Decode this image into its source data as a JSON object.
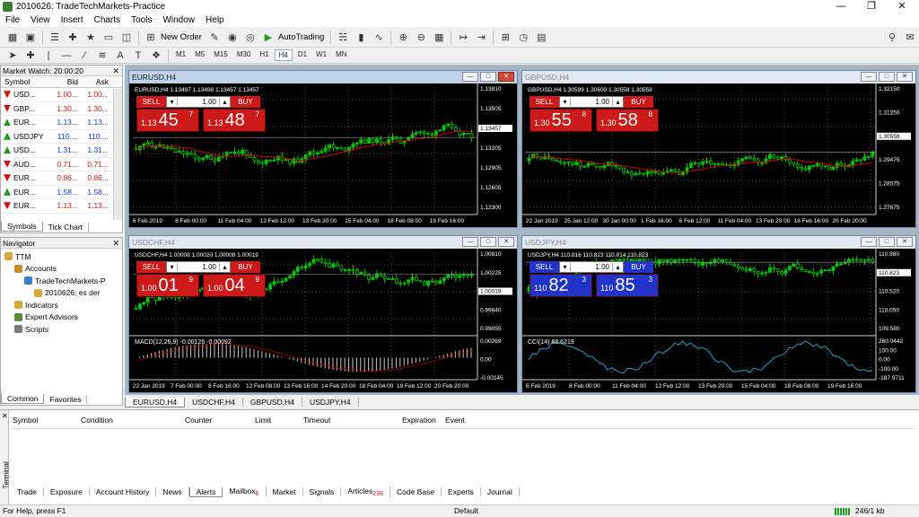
{
  "window": {
    "title": "2010626: TradeTechMarkets-Practice"
  },
  "menu": [
    "File",
    "View",
    "Insert",
    "Charts",
    "Tools",
    "Window",
    "Help"
  ],
  "toolbar": {
    "new_order": "New Order",
    "autotrading": "AutoTrading"
  },
  "timeframes": [
    "M1",
    "M5",
    "M15",
    "M30",
    "H1",
    "H4",
    "D1",
    "W1",
    "MN"
  ],
  "active_timeframe": "H4",
  "market_watch": {
    "title": "Market Watch: 20:00:20",
    "headers": {
      "symbol": "Symbol",
      "bid": "Bid",
      "ask": "Ask"
    },
    "rows": [
      {
        "symbol": "USD...",
        "bid": "1.00...",
        "ask": "1.00...",
        "dir": "dn"
      },
      {
        "symbol": "GBP...",
        "bid": "1.30...",
        "ask": "1.30...",
        "dir": "dn"
      },
      {
        "symbol": "EUR...",
        "bid": "1.13...",
        "ask": "1.13...",
        "dir": "up"
      },
      {
        "symbol": "USDJPY",
        "bid": "110....",
        "ask": "110....",
        "dir": "up"
      },
      {
        "symbol": "USD...",
        "bid": "1.31...",
        "ask": "1.31...",
        "dir": "up"
      },
      {
        "symbol": "AUD...",
        "bid": "0.71...",
        "ask": "0.71...",
        "dir": "dn"
      },
      {
        "symbol": "EUR...",
        "bid": "0.86...",
        "ask": "0.86...",
        "dir": "dn"
      },
      {
        "symbol": "EUR...",
        "bid": "1.58...",
        "ask": "1.58...",
        "dir": "up"
      },
      {
        "symbol": "EUR...",
        "bid": "1.13...",
        "ask": "1.13...",
        "dir": "dn"
      }
    ],
    "tabs": [
      "Symbols",
      "Tick Chart"
    ]
  },
  "navigator": {
    "title": "Navigator",
    "items": [
      {
        "label": "TTM",
        "indent": 0,
        "color": "#d6a93a"
      },
      {
        "label": "Accounts",
        "indent": 1,
        "color": "#c98b2a"
      },
      {
        "label": "TradeTechMarkets-P",
        "indent": 2,
        "color": "#3a7fd0"
      },
      {
        "label": "2010626: es der",
        "indent": 3,
        "color": "#d6a93a"
      },
      {
        "label": "Indicators",
        "indent": 1,
        "color": "#d6a93a"
      },
      {
        "label": "Expert Advisors",
        "indent": 1,
        "color": "#5a8a3a"
      },
      {
        "label": "Scripts",
        "indent": 1,
        "color": "#7a7a7a"
      }
    ],
    "tabs": [
      "Common",
      "Favorites"
    ]
  },
  "charts": [
    {
      "title": "EURUSD,H4",
      "active": true,
      "info": "EURUSD,H4  1.13497 1.13498 1.13457 1.13457",
      "sell_small": "1.13",
      "sell_big": "45",
      "sell_sup": "7",
      "buy_small": "1.13",
      "buy_big": "48",
      "buy_sup": "7",
      "volume": "1.00",
      "sell": "SELL",
      "buy": "BUY",
      "price_labels": [
        "1.13810",
        "1.13505",
        "1.13457",
        "1.13205",
        "1.12905",
        "1.12605",
        "1.12300"
      ],
      "current_price": "1.13457",
      "x_labels": [
        "6 Feb 2019",
        "8 Feb 00:00",
        "11 Feb 04:00",
        "12 Feb 12:00",
        "13 Feb 20:00",
        "15 Feb 04:00",
        "18 Feb 08:00",
        "19 Feb 16:00"
      ]
    },
    {
      "title": "GBPUSD,H4",
      "active": false,
      "info": "GBPUSD,H4  1.30599 1.30600 1.30558 1.30558",
      "sell_small": "1.30",
      "sell_big": "55",
      "sell_sup": "8",
      "buy_small": "1.30",
      "buy_big": "58",
      "buy_sup": "8",
      "volume": "1.00",
      "sell": "SELL",
      "buy": "BUY",
      "price_labels": [
        "1.32150",
        "1.31250",
        "1.30558",
        "1.29475",
        "1.28575",
        "1.27675"
      ],
      "current_price": "1.30558",
      "x_labels": [
        "22 Jan 2019",
        "25 Jan 12:00",
        "30 Jan 00:00",
        "1 Feb 16:00",
        "6 Feb 12:00",
        "11 Feb 04:00",
        "13 Feb 20:00",
        "18 Feb 16:00",
        "20 Feb 20:00"
      ]
    },
    {
      "title": "USDCHF,H4",
      "active": false,
      "info": "USDCHF,H4  1.00008 1.00020 1.00008 1.00019",
      "sell_small": "1.00",
      "sell_big": "01",
      "sell_sup": "9",
      "buy_small": "1.00",
      "buy_big": "04",
      "buy_sup": "9",
      "volume": "1.00",
      "sell": "SELL",
      "buy": "BUY",
      "price_labels": [
        "1.00810",
        "1.00225",
        "1.00019",
        "0.99640",
        "0.99055"
      ],
      "current_price": "1.00019",
      "indicator": "MACD(12,26,9) -0.00126 -0.00092",
      "indicator_labels": [
        "0.00269",
        "0.00",
        "-0.00145"
      ],
      "x_labels": [
        "22 Jan 2019",
        "7 Feb 00:00",
        "8 Feb 16:00",
        "12 Feb 08:00",
        "13 Feb 16:00",
        "14 Feb 20:00",
        "18 Feb 04:00",
        "19 Feb 12:00",
        "20 Feb 20:00"
      ]
    },
    {
      "title": "USDJPY,H4",
      "active": false,
      "info": "USDJPY,H4  110.816 110.823 110.814 110.823",
      "sell_small": "110",
      "sell_big": "82",
      "sell_sup": "3",
      "buy_small": "110",
      "buy_big": "85",
      "buy_sup": "3",
      "volume": "1.00",
      "sell": "SELL",
      "buy": "BUY",
      "price_labels": [
        "110.980",
        "110.823",
        "110.520",
        "110.050",
        "109.580"
      ],
      "current_price": "110.823",
      "indicator": "CCI(14) 88.6219",
      "indicator_labels": [
        "260.0442",
        "100.00",
        "0.00",
        "-100.00",
        "-187.9711"
      ],
      "x_labels": [
        "6 Feb 2019",
        "8 Feb 00:00",
        "11 Feb 04:00",
        "12 Feb 12:00",
        "13 Feb 20:00",
        "15 Feb 04:00",
        "18 Feb 08:00",
        "19 Feb 16:00"
      ]
    }
  ],
  "chart_tabs": [
    "EURUSD,H4",
    "USDCHF,H4",
    "GBPUSD,H4",
    "USDJPY,H4"
  ],
  "terminal": {
    "label": "Terminal",
    "headers": [
      "Symbol",
      "Condition",
      "Counter",
      "Limit",
      "Timeout",
      "Expiration",
      "Event"
    ],
    "tabs": [
      {
        "label": "Trade"
      },
      {
        "label": "Exposure"
      },
      {
        "label": "Account History"
      },
      {
        "label": "News"
      },
      {
        "label": "Alerts",
        "active": true
      },
      {
        "label": "Mailbox",
        "badge": "6"
      },
      {
        "label": "Market"
      },
      {
        "label": "Signals"
      },
      {
        "label": "Articles",
        "badge": "238"
      },
      {
        "label": "Code Base"
      },
      {
        "label": "Experts"
      },
      {
        "label": "Journal"
      }
    ]
  },
  "status": {
    "help": "For Help, press F1",
    "profile": "Default",
    "traffic": "246/1 kb"
  },
  "colors": {
    "bull": "#00c800",
    "bear": "#00c800",
    "ma": "#d40000",
    "sell": "#cc1a1a",
    "buy_blue": "#2233c8"
  }
}
